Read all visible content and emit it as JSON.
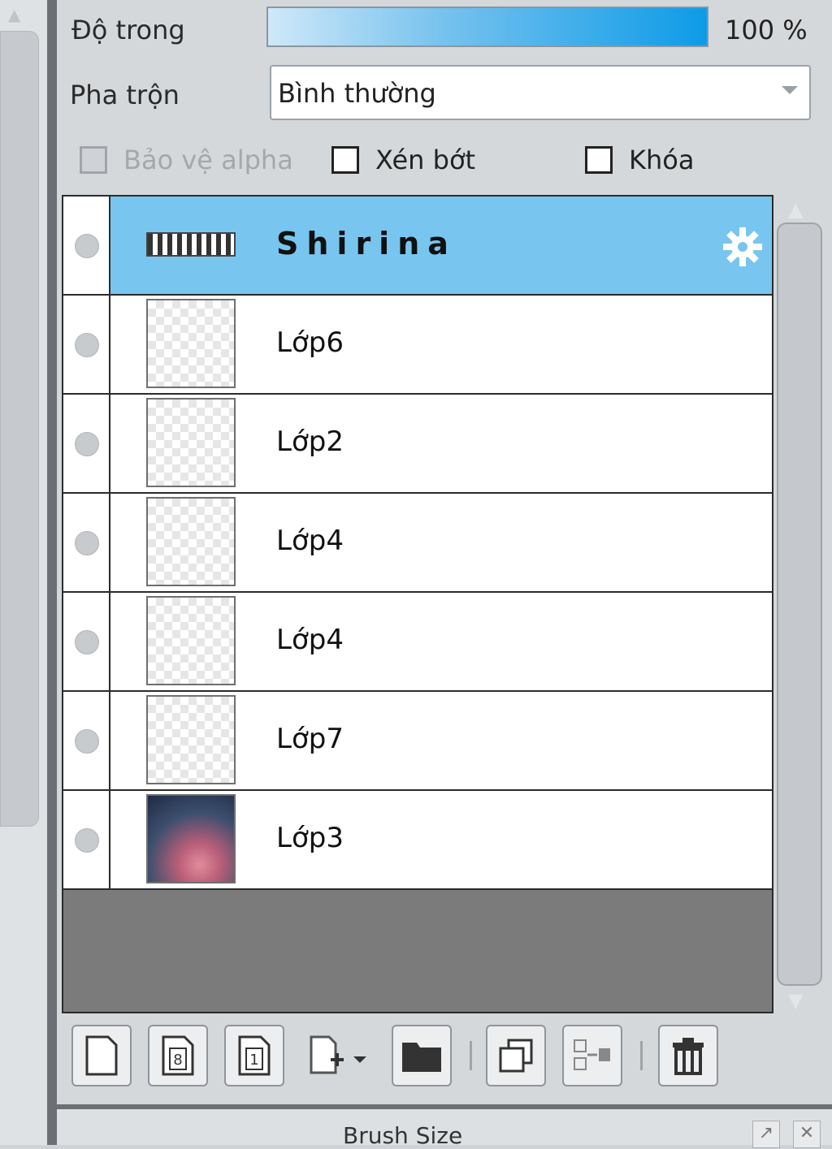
{
  "opacity": {
    "label": "Độ trong",
    "value_text": "100 %",
    "value": 100
  },
  "blend": {
    "label": "Pha trộn",
    "value": "Bình thường"
  },
  "checkboxes": {
    "protect_alpha": {
      "label": "Bảo vệ alpha",
      "checked": false,
      "disabled": true
    },
    "clip": {
      "label": "Xén bớt",
      "checked": false
    },
    "lock": {
      "label": "Khóa",
      "checked": false
    }
  },
  "layers": [
    {
      "name": "Shirina",
      "selected": true,
      "type": "text"
    },
    {
      "name": "Lớp6"
    },
    {
      "name": "Lớp2"
    },
    {
      "name": "Lớp4"
    },
    {
      "name": "Lớp4"
    },
    {
      "name": "Lớp7"
    },
    {
      "name": "Lớp3",
      "type": "image"
    }
  ],
  "bottom_panel": {
    "title": "Brush Size"
  },
  "colors": {
    "selected_row": "#78c6f0",
    "opacity_fill": "#0d9be7"
  }
}
